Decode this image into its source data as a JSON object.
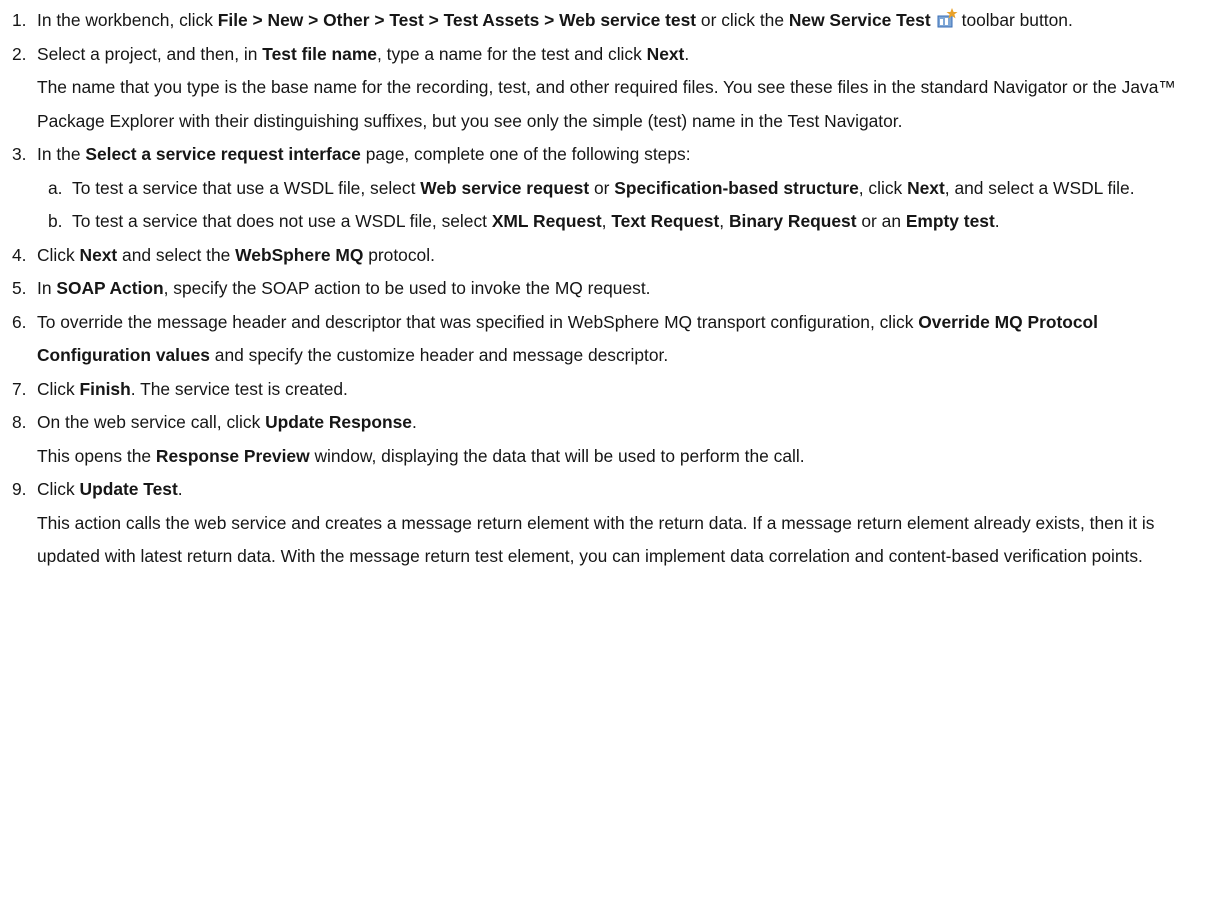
{
  "steps": [
    {
      "num": "1.",
      "text": [
        "In the workbench, click ",
        {
          "b": "File > New > Other > Test > Test Assets > Web service test"
        },
        " or click the ",
        {
          "b": "New Service Test"
        },
        {
          "icon": "new-service-test-icon"
        },
        "toolbar button."
      ]
    },
    {
      "num": "2.",
      "text": [
        "Select a project, and then, in ",
        {
          "b": "Test file name"
        },
        ", type a name for the test and click ",
        {
          "b": "Next"
        },
        "."
      ],
      "note": "The name that you type is the base name for the recording, test, and other required files. You see these files in the standard Navigator or the Java™ Package Explorer with their distinguishing suffixes, but you see only the simple (test) name in the Test Navigator."
    },
    {
      "num": "3.",
      "text": [
        "In the ",
        {
          "b": "Select a service request interface"
        },
        " page, complete one of the following steps:"
      ],
      "sub": [
        {
          "num": "a.",
          "text": [
            "To test a service that use a WSDL file, select ",
            {
              "b": "Web service request"
            },
            " or ",
            {
              "b": "Specification-based structure"
            },
            ", click ",
            {
              "b": "Next"
            },
            ", and select a WSDL file."
          ]
        },
        {
          "num": "b.",
          "text": [
            "To test a service that does not use a WSDL file, select ",
            {
              "b": "XML Request"
            },
            ", ",
            {
              "b": "Text Request"
            },
            ", ",
            {
              "b": "Binary Request"
            },
            " or an ",
            {
              "b": "Empty test"
            },
            "."
          ]
        }
      ]
    },
    {
      "num": "4.",
      "text": [
        "Click ",
        {
          "b": "Next"
        },
        " and select the ",
        {
          "b": "WebSphere MQ"
        },
        " protocol."
      ]
    },
    {
      "num": "5.",
      "text": [
        "In ",
        {
          "b": "SOAP Action"
        },
        ", specify the SOAP action to be used to invoke the MQ request."
      ]
    },
    {
      "num": "6.",
      "text": [
        "To override the message header and descriptor that was specified in WebSphere MQ transport configuration, click ",
        {
          "b": "Override MQ Protocol Configuration values"
        },
        " and specify the customize header and message descriptor."
      ]
    },
    {
      "num": "7.",
      "text": [
        "Click ",
        {
          "b": "Finish"
        },
        ". The service test is created."
      ]
    },
    {
      "num": "8.",
      "text": [
        "On the web service call, click ",
        {
          "b": "Update Response"
        },
        "."
      ],
      "note_rich": [
        "This opens the ",
        {
          "b": "Response Preview"
        },
        " window, displaying the data that will be used to perform the call."
      ]
    },
    {
      "num": "9.",
      "text": [
        "Click ",
        {
          "b": "Update Test"
        },
        "."
      ],
      "note": "This action calls the web service and creates a message return element with the return data. If a message return element already exists, then it is updated with latest return data. With the message return test element, you can implement data correlation and content-based verification points."
    }
  ],
  "colors": {
    "text": "#161616",
    "icon_accent": "#e8a12a",
    "icon_blue": "#3a6db5"
  }
}
